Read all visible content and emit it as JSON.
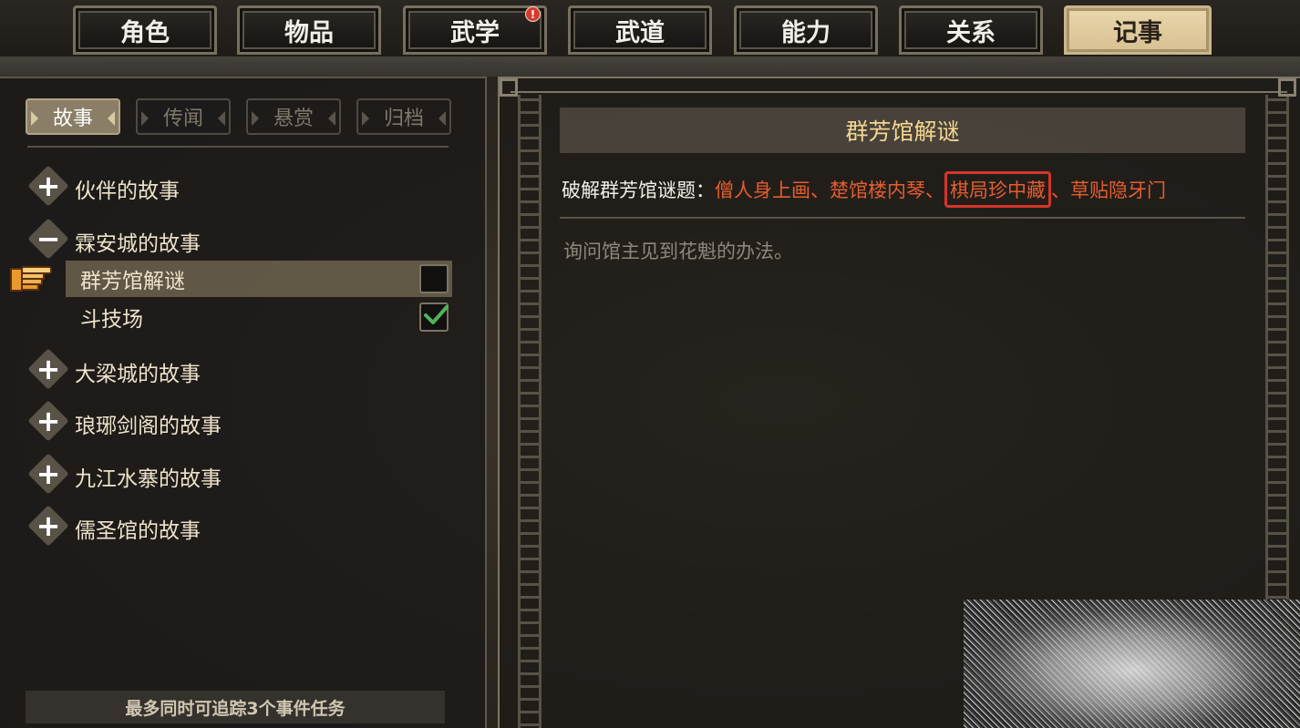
{
  "top_tabs": [
    {
      "label": "角色",
      "active": false
    },
    {
      "label": "物品",
      "active": false
    },
    {
      "label": "武学",
      "active": false,
      "badge": "!"
    },
    {
      "label": "武道",
      "active": false
    },
    {
      "label": "能力",
      "active": false
    },
    {
      "label": "关系",
      "active": false
    },
    {
      "label": "记事",
      "active": true
    }
  ],
  "sub_tabs": [
    {
      "label": "故事",
      "active": true
    },
    {
      "label": "传闻",
      "active": false
    },
    {
      "label": "悬赏",
      "active": false
    },
    {
      "label": "归档",
      "active": false
    }
  ],
  "story_groups": [
    {
      "label": "伙伴的故事",
      "toggle": "+"
    },
    {
      "label": "霖安城的故事",
      "toggle": "−",
      "quests": [
        {
          "label": "群芳馆解谜",
          "selected": true,
          "completed": false
        },
        {
          "label": "斗技场",
          "selected": false,
          "completed": true
        }
      ]
    },
    {
      "label": "大梁城的故事",
      "toggle": "+"
    },
    {
      "label": "琅琊剑阁的故事",
      "toggle": "+"
    },
    {
      "label": "九江水寨的故事",
      "toggle": "+"
    },
    {
      "label": "儒圣馆的故事",
      "toggle": "+"
    }
  ],
  "footer_note": "最多同时可追踪3个事件任务",
  "detail": {
    "title": "群芳馆解谜",
    "objective_prefix": "破解群芳馆谜题：",
    "objective_items": [
      "僧人身上画",
      "楚馆楼内琴",
      "棋局珍中藏",
      "草贴隐牙门"
    ],
    "objective_separator": "、",
    "highlighted_item_index": 2,
    "description": "询问馆主见到花魁的办法。"
  },
  "colors": {
    "title_gold": "#f3d690",
    "objective_orange": "#e55d2e",
    "highlight_red": "#d6342a",
    "check_green": "#4fb35a"
  }
}
